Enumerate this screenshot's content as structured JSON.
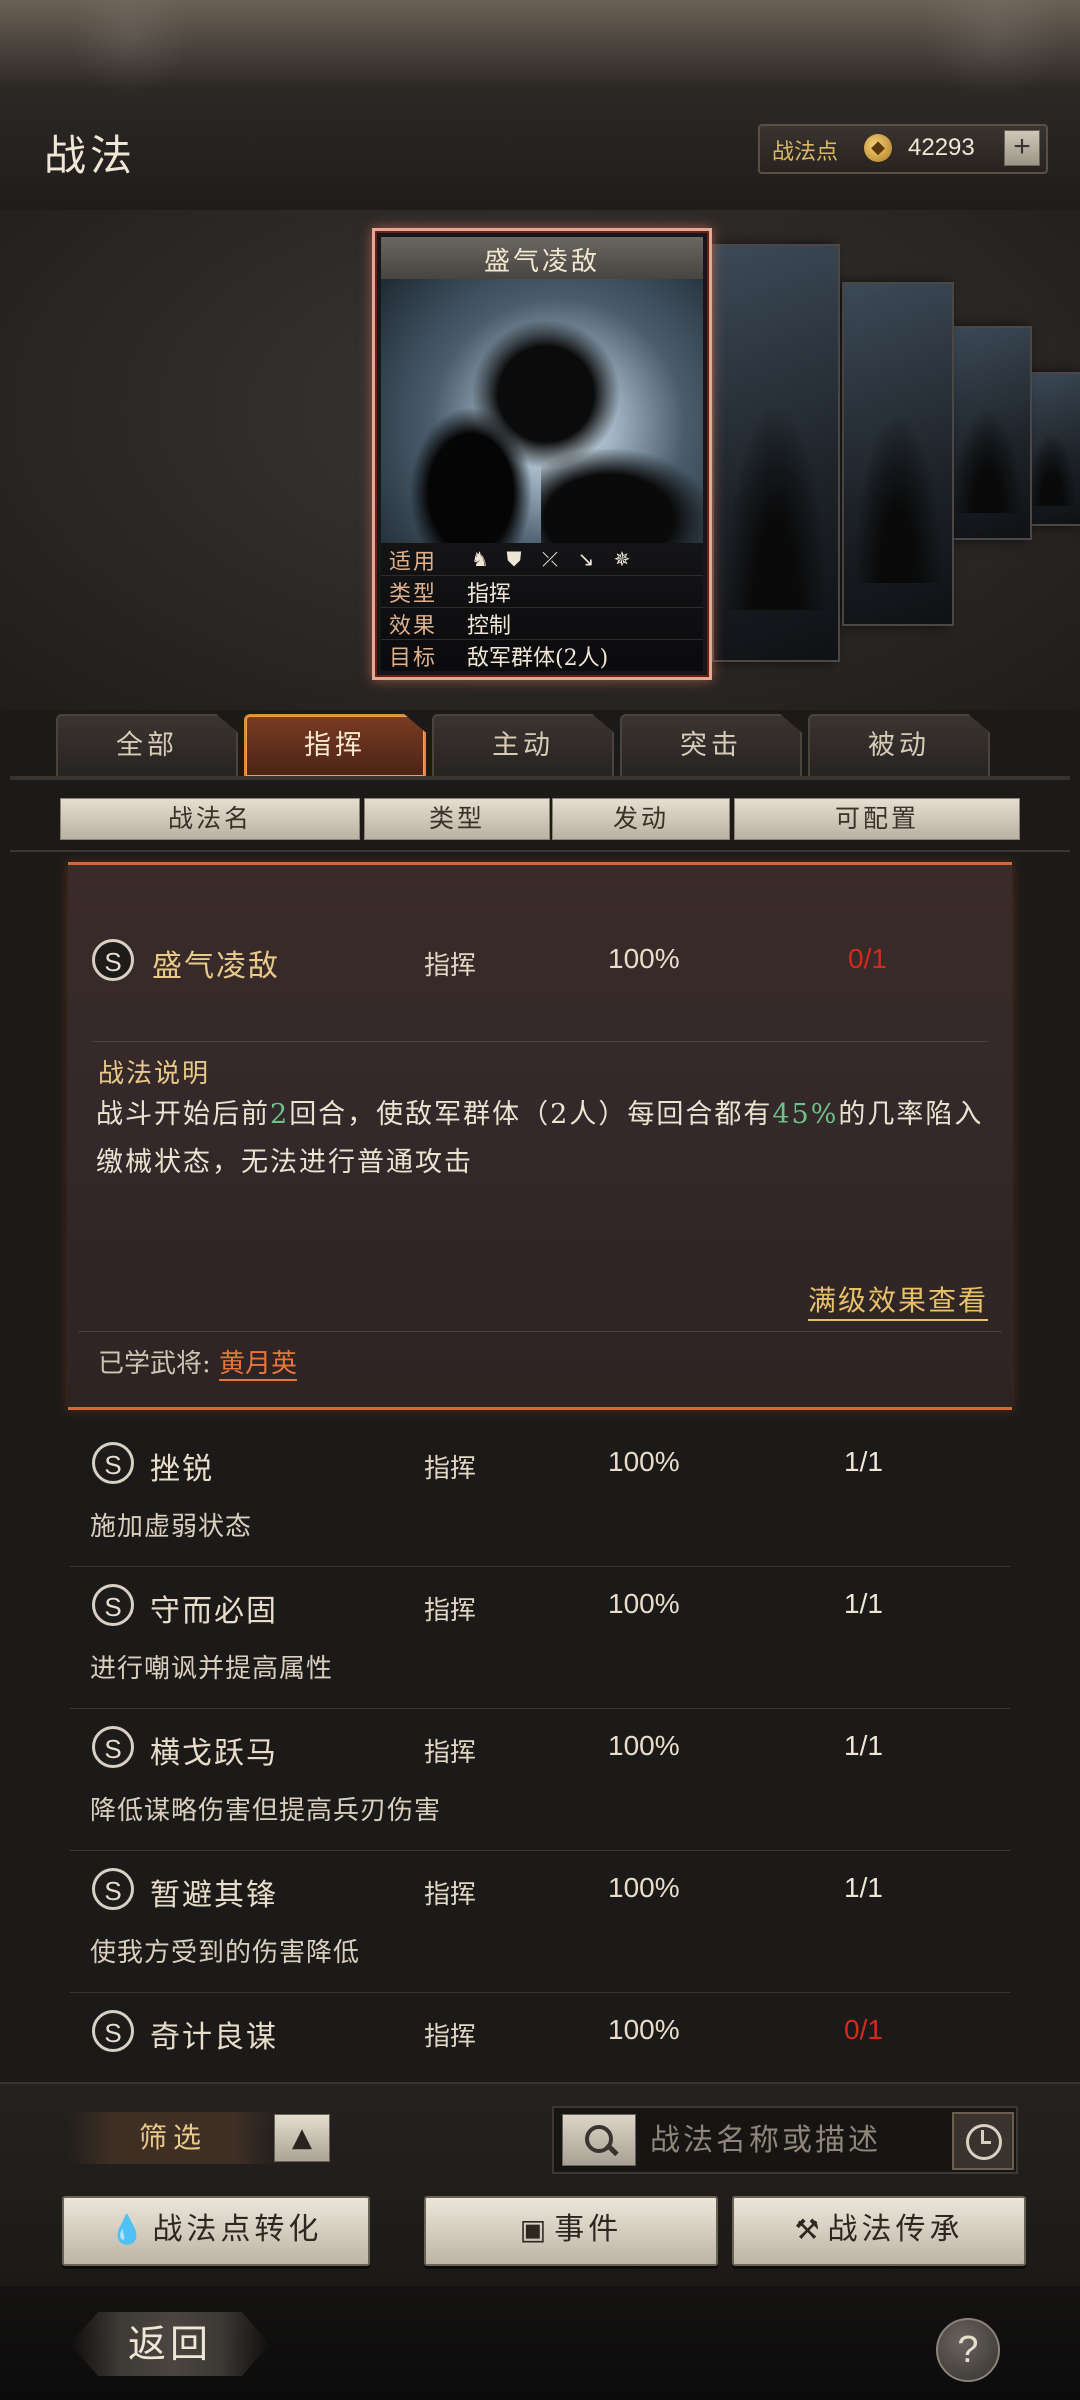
{
  "header": {
    "title": "战法",
    "points_label": "战法点",
    "points_value": "42293",
    "plus_label": "+"
  },
  "card": {
    "name": "盛气凌敌",
    "rows": [
      {
        "key": "适用",
        "value": ""
      },
      {
        "key": "类型",
        "value": "指挥"
      },
      {
        "key": "效果",
        "value": "控制"
      },
      {
        "key": "目标",
        "value": "敌军群体(2人)"
      }
    ],
    "troop_icons": [
      "cavalry-icon",
      "shield-icon",
      "bow-icon",
      "spear-icon",
      "wheel-icon"
    ]
  },
  "tabs": [
    {
      "label": "全部",
      "active": false
    },
    {
      "label": "指挥",
      "active": true
    },
    {
      "label": "主动",
      "active": false
    },
    {
      "label": "突击",
      "active": false
    },
    {
      "label": "被动",
      "active": false
    }
  ],
  "columns": [
    "战法名",
    "类型",
    "发动",
    "可配置"
  ],
  "expanded": {
    "grade": "S",
    "name": "盛气凌敌",
    "type": "指挥",
    "rate": "100%",
    "config": "0/1",
    "desc_title": "战法说明",
    "desc_parts": [
      "战斗开始后前",
      "2",
      "回合，使敌军群体（2人）每回合都有",
      "45%",
      "的几率陷入缴械状态，无法进行普通攻击"
    ],
    "full_effect_link": "满级效果查看",
    "learned_label": "已学武将:",
    "learned_name": "黄月英"
  },
  "rows": [
    {
      "grade": "S",
      "name": "挫锐",
      "type": "指挥",
      "rate": "100%",
      "config": "1/1",
      "desc": "施加虚弱状态"
    },
    {
      "grade": "S",
      "name": "守而必固",
      "type": "指挥",
      "rate": "100%",
      "config": "1/1",
      "desc": "进行嘲讽并提高属性"
    },
    {
      "grade": "S",
      "name": "横戈跃马",
      "type": "指挥",
      "rate": "100%",
      "config": "1/1",
      "desc": "降低谋略伤害但提高兵刃伤害"
    },
    {
      "grade": "S",
      "name": "暂避其锋",
      "type": "指挥",
      "rate": "100%",
      "config": "1/1",
      "desc": "使我方受到的伤害降低"
    },
    {
      "grade": "S",
      "name": "奇计良谋",
      "type": "指挥",
      "rate": "100%",
      "config": "0/1",
      "desc": ""
    }
  ],
  "controls": {
    "filter_label": "筛选",
    "search_placeholder": "战法名称或描述",
    "convert_button": "战法点转化",
    "event_button": "事件",
    "inherit_button": "战法传承"
  },
  "footer": {
    "back_label": "返回",
    "help_label": "?"
  },
  "colors": {
    "accent_orange": "#d4683a",
    "config_full": "#efe6d6",
    "config_empty": "#d22a1e",
    "highlight_green": "#6fc18a",
    "gold": "#e8c06a"
  }
}
